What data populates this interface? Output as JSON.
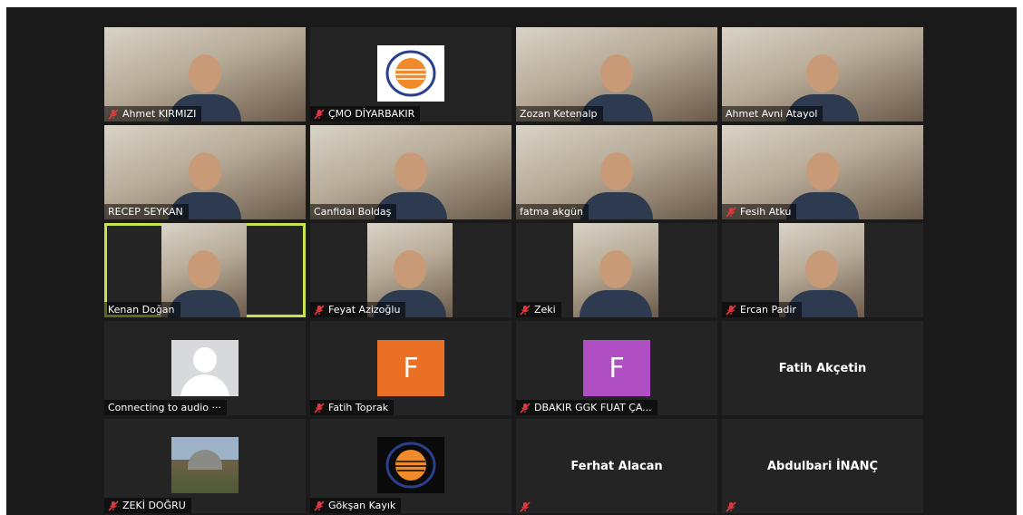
{
  "participants": [
    {
      "name": "Ahmet KIRMIZI",
      "muted": true,
      "kind": "video"
    },
    {
      "name": "ÇMO DİYARBAKIR",
      "muted": true,
      "kind": "logo"
    },
    {
      "name": "Zozan Ketenalp",
      "muted": false,
      "kind": "video"
    },
    {
      "name": "Ahmet Avni Atayol",
      "muted": false,
      "kind": "video"
    },
    {
      "name": "RECEP SEYKAN",
      "muted": false,
      "kind": "video"
    },
    {
      "name": "Canfidal Boldaş",
      "muted": false,
      "kind": "video"
    },
    {
      "name": "fatma akgün",
      "muted": false,
      "kind": "video"
    },
    {
      "name": "Fesih Atku",
      "muted": true,
      "kind": "video"
    },
    {
      "name": "Kenan Doğan",
      "muted": false,
      "kind": "video-narrow",
      "active": true
    },
    {
      "name": "Feyat Azizoğlu",
      "muted": true,
      "kind": "video-narrow"
    },
    {
      "name": "Zeki",
      "muted": true,
      "kind": "video-narrow"
    },
    {
      "name": "Ercan Padir",
      "muted": true,
      "kind": "video-narrow"
    },
    {
      "name": "Connecting to audio ···",
      "muted": false,
      "kind": "generic-avatar"
    },
    {
      "name": "Fatih Toprak",
      "muted": true,
      "kind": "letter",
      "letter": "F",
      "color": "#ea7026"
    },
    {
      "name": "DBAKIR GGK FUAT ÇA...",
      "muted": true,
      "kind": "letter",
      "letter": "F",
      "color": "#b04fc4"
    },
    {
      "name": "Fatih Akçetin",
      "muted": false,
      "kind": "name-only"
    },
    {
      "name": "ZEKİ DOĞRU",
      "muted": true,
      "kind": "photo"
    },
    {
      "name": "Gökşan Kayık",
      "muted": true,
      "kind": "logo-dark"
    },
    {
      "name": "Ferhat Alacan",
      "muted": true,
      "kind": "name-only"
    },
    {
      "name": "Abdulbari İNANÇ",
      "muted": true,
      "kind": "name-only"
    }
  ],
  "colors": {
    "window_bg": "#1a1a1a",
    "tile_bg": "#242424",
    "active_border": "#c7e44a",
    "mute_icon": "#e0393e"
  },
  "icons": {
    "mute": "microphone-muted-icon",
    "avatar": "user-avatar-icon"
  }
}
